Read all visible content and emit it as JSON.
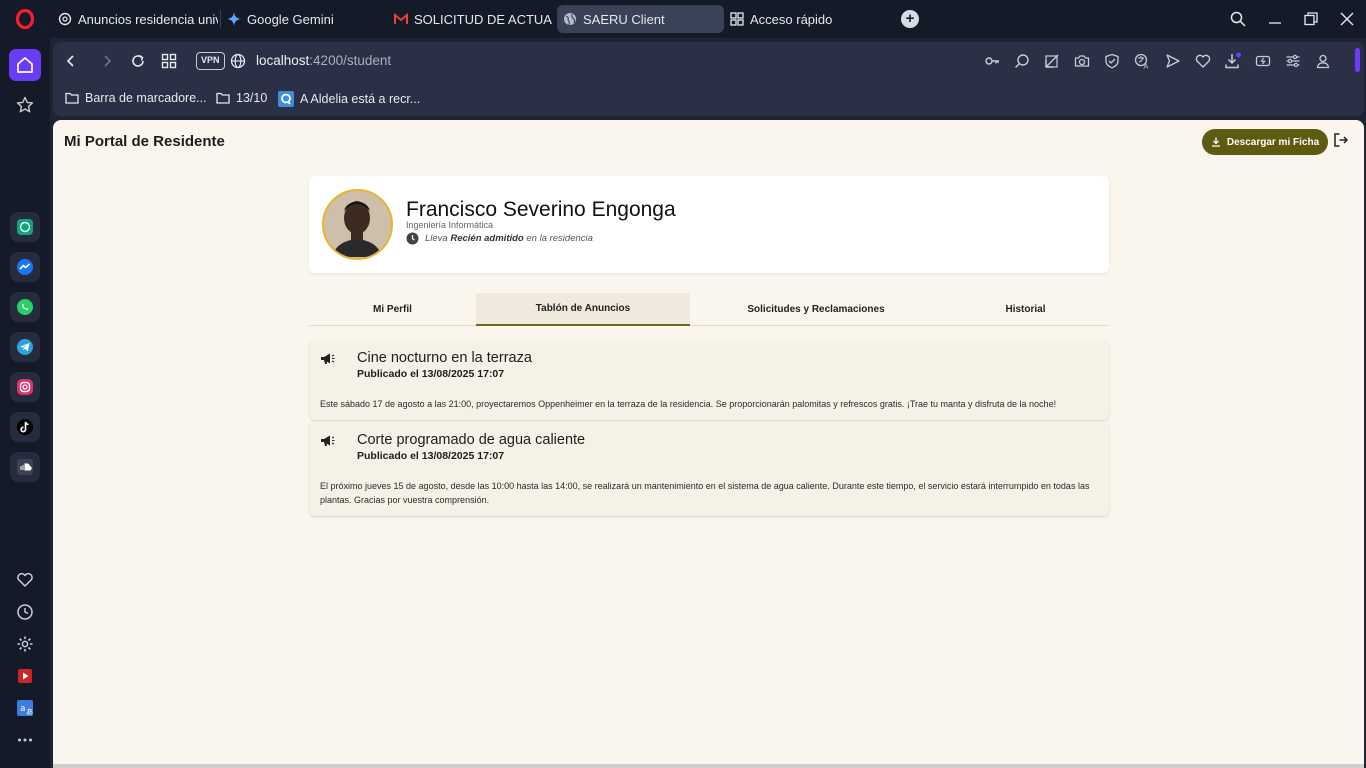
{
  "browser": {
    "tabs": [
      {
        "title": "Anuncios residencia universitaria",
        "icon": "openai-icon"
      },
      {
        "title": "Google Gemini",
        "icon": "gemini-icon"
      },
      {
        "title": "SOLICITUD DE ACTUALIZACIÓN",
        "icon": "gmail-icon"
      },
      {
        "title": "SAERU Client",
        "icon": "globe-icon",
        "active": true
      },
      {
        "title": "Acceso rápido",
        "icon": "grid-icon"
      }
    ],
    "new_tab": "+",
    "vpn": "VPN",
    "url_host": "localhost",
    "url_rest": ":4200/student",
    "bookmarks": [
      {
        "label": "Barra de marcadore...",
        "icon": "folder-icon"
      },
      {
        "label": "13/10",
        "icon": "folder-icon"
      },
      {
        "label": "A Aldelia está a recr...",
        "icon": "q-icon"
      }
    ],
    "accent": "#6b3cf5"
  },
  "header": {
    "title": "Mi Portal de Residente",
    "download_label": "Descargar mi Ficha"
  },
  "profile": {
    "name": "Francisco Severino Engonga",
    "degree": "Ingeniería Informática",
    "status_prefix": "Lleva",
    "status_value": "Recién admitido",
    "status_suffix": "en la residencia"
  },
  "tabs": [
    {
      "label": "Mi Perfil"
    },
    {
      "label": "Tablón de Anuncios",
      "active": true
    },
    {
      "label": "Solicitudes y Reclamaciones"
    },
    {
      "label": "Historial"
    }
  ],
  "announcements": [
    {
      "title": "Cine nocturno en la terraza",
      "date": "Publicado el 13/08/2025 17:07",
      "body": "Este sábado 17 de agosto a las 21:00, proyectaremos Oppenheimer en la terraza de la residencia. Se proporcionarán palomitas y refrescos gratis. ¡Trae tu manta y disfruta de la noche!"
    },
    {
      "title": "Corte programado de agua caliente",
      "date": "Publicado el 13/08/2025 17:07",
      "body": "El próximo jueves 15 de agosto, desde las 10:00 hasta las 14:00, se realizará un mantenimiento en el sistema de agua caliente. Durante este tiempo, el servicio estará interrumpido en todas las plantas. Gracias por vuestra comprensión."
    }
  ],
  "colors": {
    "primary": "#5e5a10",
    "page_bg": "#faf6ee",
    "avatar_ring": "#e8b530"
  }
}
